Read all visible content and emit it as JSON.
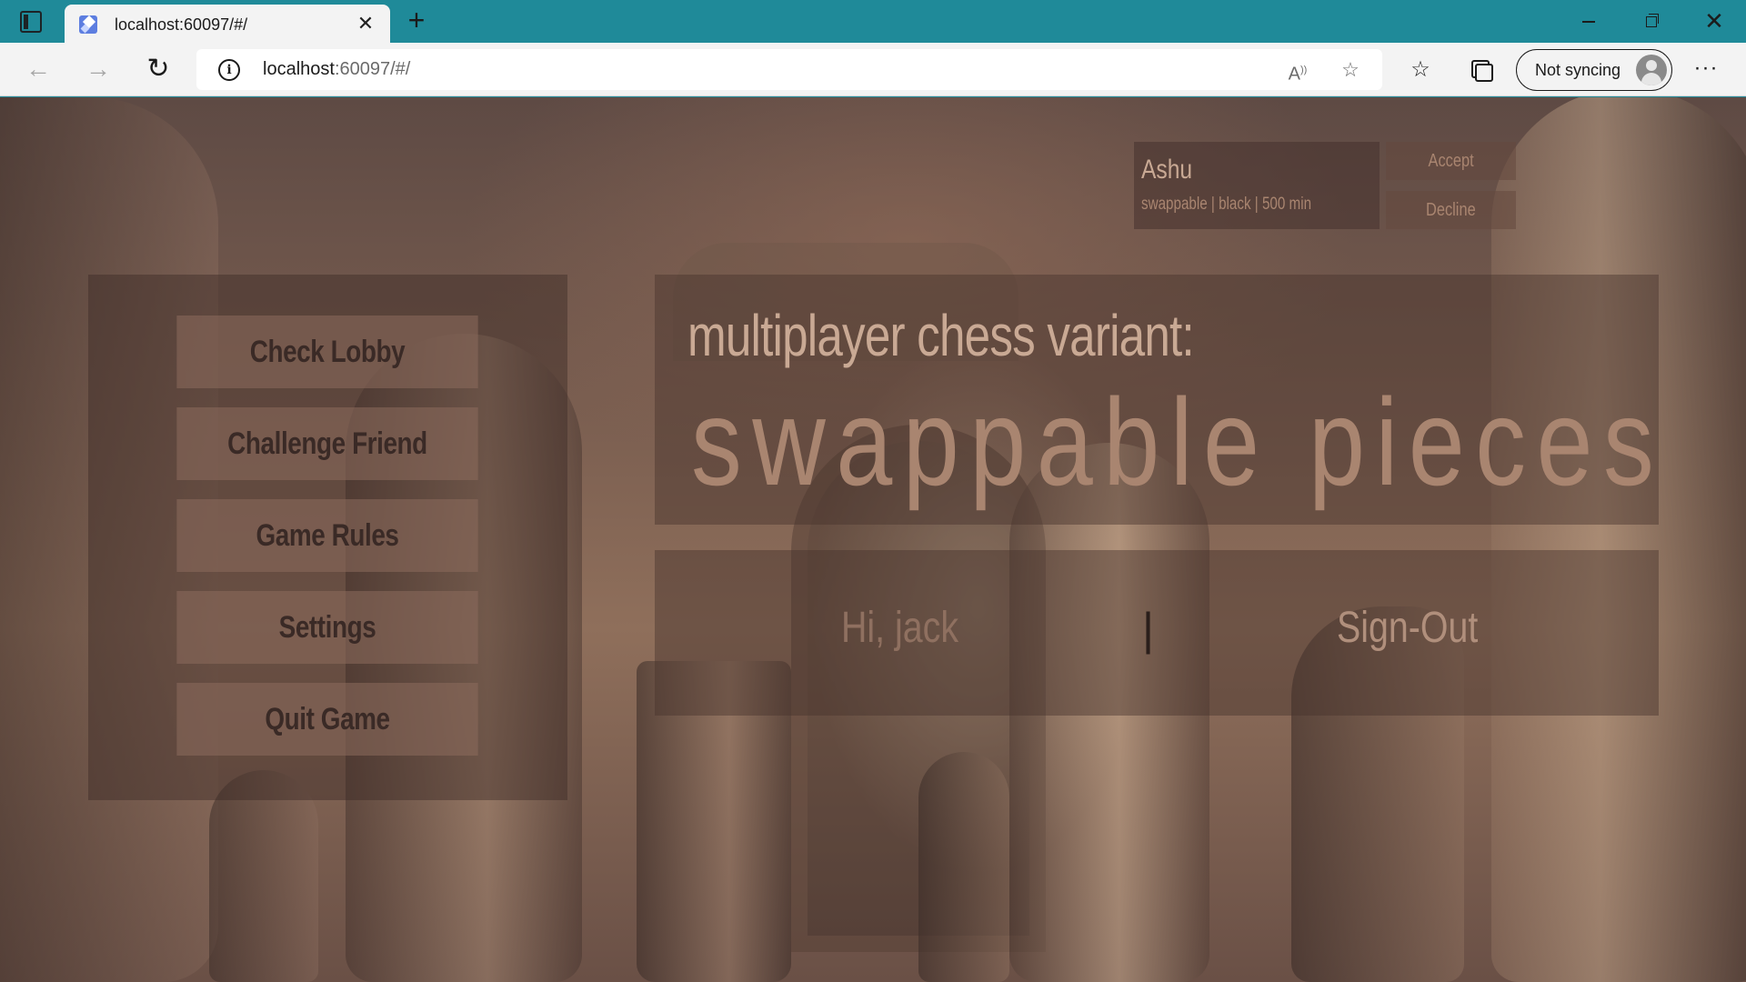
{
  "browser": {
    "tab_title": "localhost:60097/#/",
    "tab_close": "✕",
    "new_tab": "+",
    "url_host": "localhost",
    "url_rest": ":60097/#/",
    "profile_label": "Not syncing",
    "icons": {
      "sidebar": "sidebar-icon",
      "back": "arrow-left-icon",
      "forward": "arrow-right-icon",
      "reload": "reload-icon",
      "info": "info-icon",
      "read_aloud": "read-aloud-icon",
      "add_favorite": "star-plus-icon",
      "favorites": "favorites-icon",
      "collections": "collections-icon",
      "more": "more-icon"
    }
  },
  "menu": {
    "items": [
      {
        "label": "Check Lobby"
      },
      {
        "label": "Challenge Friend"
      },
      {
        "label": "Game Rules"
      },
      {
        "label": "Settings"
      },
      {
        "label": "Quit Game"
      }
    ]
  },
  "title": {
    "subtitle": "multiplayer chess variant:",
    "main": "swappable pieces"
  },
  "user": {
    "greeting": "Hi, jack",
    "divider": "|",
    "signout": "Sign-Out"
  },
  "challenge": {
    "challenger": "Ashu",
    "details": "swappable | black | 500 min",
    "accept": "Accept",
    "decline": "Decline"
  }
}
